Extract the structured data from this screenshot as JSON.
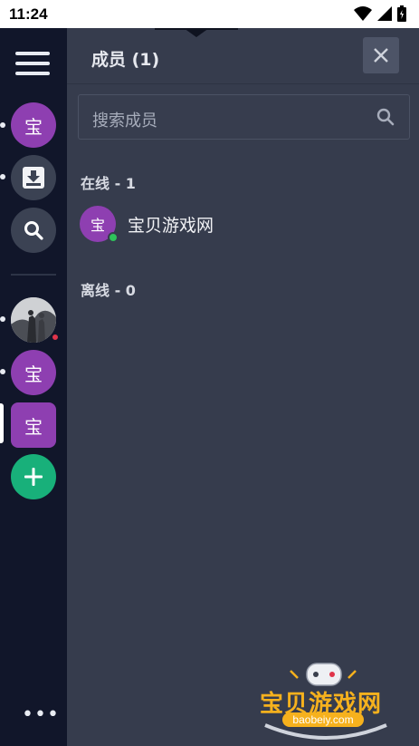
{
  "status_bar": {
    "time": "11:24"
  },
  "rail": {
    "server_initial": "宝",
    "items": [
      {
        "initial": "宝"
      },
      {
        "initial": "宝"
      },
      {
        "initial": "宝"
      }
    ],
    "more_label": "•••"
  },
  "panel": {
    "title": "成员 (1)",
    "search_placeholder": "搜索成员",
    "online_header": "在线 - 1",
    "offline_header": "离线 - 0",
    "members": [
      {
        "initial": "宝",
        "name": "宝贝游戏网",
        "status": "online"
      }
    ]
  },
  "watermark": {
    "title": "宝贝游戏网",
    "domain": "baobeiy.com"
  },
  "colors": {
    "rail_bg": "#11162a",
    "panel_bg": "#363c4d",
    "avatar_purple": "#8e3fb1",
    "add_green": "#18b07a",
    "online_green": "#2ec25a",
    "alert_red": "#e0344a"
  }
}
